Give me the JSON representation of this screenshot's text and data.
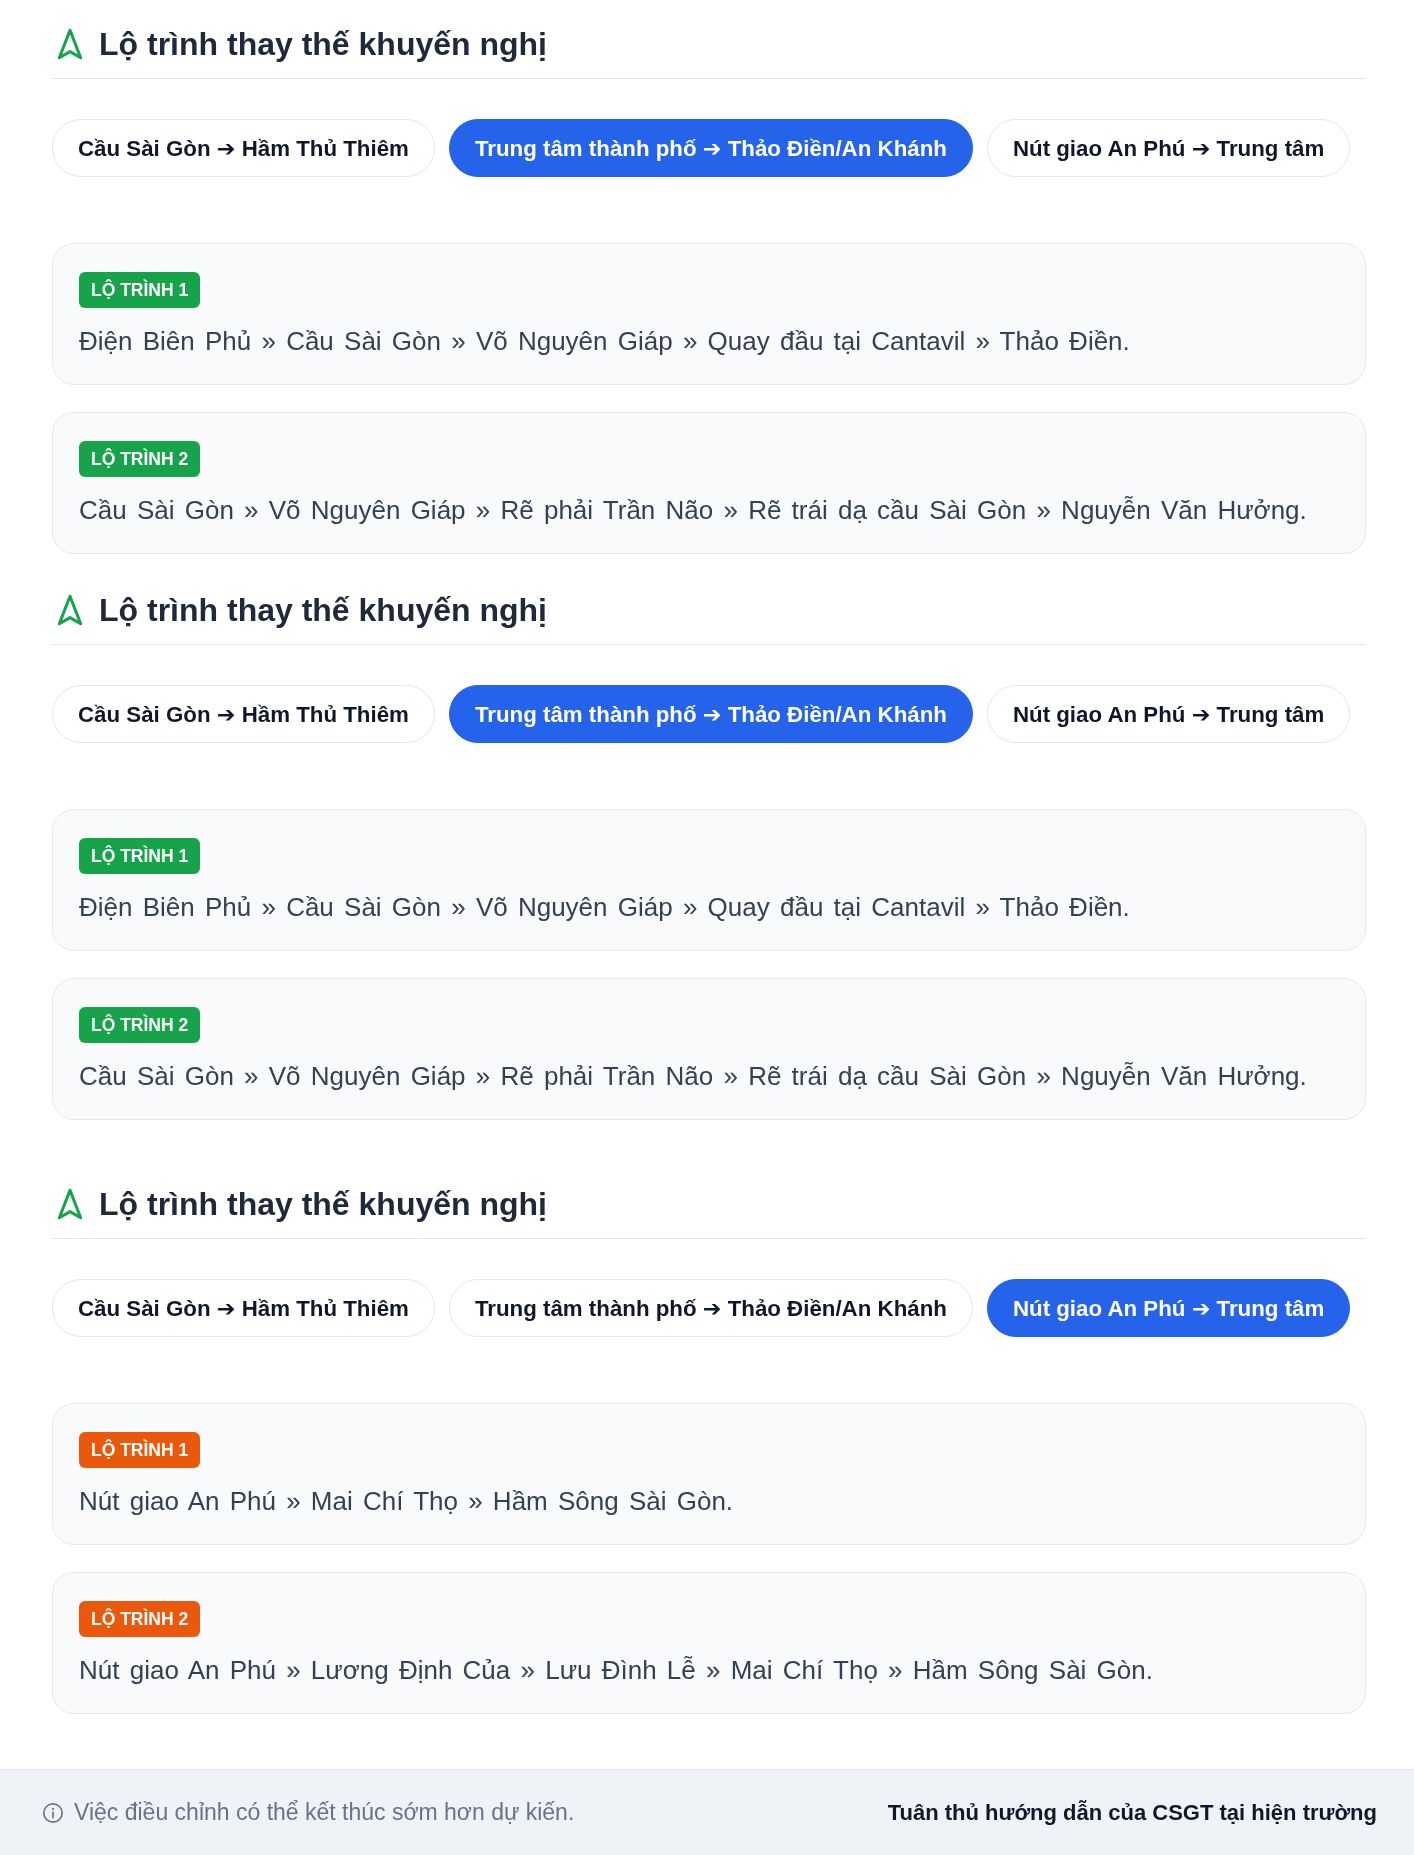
{
  "sections": [
    {
      "title": "Lộ trình thay thế khuyến nghị",
      "tabs": [
        {
          "label": "Cầu Sài Gòn ➔ Hầm Thủ Thiêm",
          "selected": false
        },
        {
          "label": "Trung tâm thành phố ➔ Thảo Điền/An Khánh",
          "selected": true
        },
        {
          "label": "Nút giao An Phú ➔ Trung tâm",
          "selected": false
        }
      ],
      "routes": [
        {
          "badge": "LỘ TRÌNH 1",
          "color": "#16a34a",
          "path": "Điện Biên Phủ » Cầu Sài Gòn » Võ Nguyên Giáp » Quay đầu tại Cantavil » Thảo Điền."
        },
        {
          "badge": "LỘ TRÌNH 2",
          "color": "#16a34a",
          "path": "Cầu Sài Gòn » Võ Nguyên Giáp » Rẽ phải Trần Não » Rẽ trái dạ cầu Sài Gòn » Nguyễn Văn Hưởng."
        }
      ]
    },
    {
      "title": "Lộ trình thay thế khuyến nghị",
      "tabs": [
        {
          "label": "Cầu Sài Gòn ➔ Hầm Thủ Thiêm",
          "selected": false
        },
        {
          "label": "Trung tâm thành phố ➔ Thảo Điền/An Khánh",
          "selected": true
        },
        {
          "label": "Nút giao An Phú ➔ Trung tâm",
          "selected": false
        }
      ],
      "routes": [
        {
          "badge": "LỘ TRÌNH 1",
          "color": "#16a34a",
          "path": "Điện Biên Phủ » Cầu Sài Gòn » Võ Nguyên Giáp » Quay đầu tại Cantavil » Thảo Điền."
        },
        {
          "badge": "LỘ TRÌNH 2",
          "color": "#16a34a",
          "path": "Cầu Sài Gòn » Võ Nguyên Giáp » Rẽ phải Trần Não » Rẽ trái dạ cầu Sài Gòn » Nguyễn Văn Hưởng."
        }
      ]
    },
    {
      "title": "Lộ trình thay thế khuyến nghị",
      "tabs": [
        {
          "label": "Cầu Sài Gòn ➔ Hầm Thủ Thiêm",
          "selected": false
        },
        {
          "label": "Trung tâm thành phố ➔ Thảo Điền/An Khánh",
          "selected": false
        },
        {
          "label": "Nút giao An Phú ➔ Trung tâm",
          "selected": true
        }
      ],
      "routes": [
        {
          "badge": "LỘ TRÌNH 1",
          "color": "#ea580c",
          "path": "Nút giao An Phú » Mai Chí Thọ » Hầm Sông Sài Gòn."
        },
        {
          "badge": "LỘ TRÌNH 2",
          "color": "#ea580c",
          "path": "Nút giao An Phú » Lương Định Của » Lưu Đình Lễ » Mai Chí Thọ » Hầm Sông Sài Gòn."
        }
      ]
    }
  ],
  "footer": {
    "note": "Việc điều chỉnh có thể kết thúc sớm hơn dự kiến.",
    "advice": "Tuân thủ hướng dẫn của CSGT tại hiện trường"
  }
}
